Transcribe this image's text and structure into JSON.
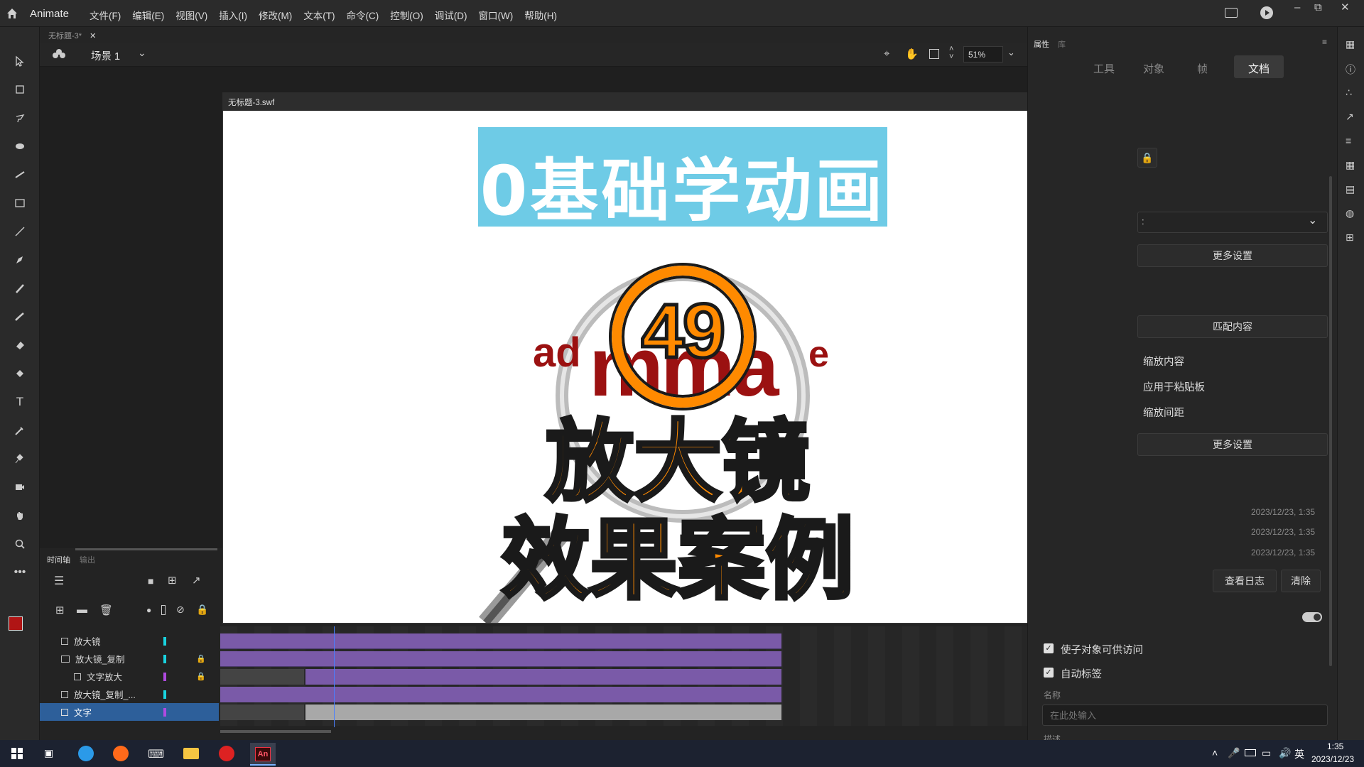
{
  "app": {
    "name": "Animate"
  },
  "menu": [
    "文件(F)",
    "编辑(E)",
    "视图(V)",
    "插入(I)",
    "修改(M)",
    "文本(T)",
    "命令(C)",
    "控制(O)",
    "调试(D)",
    "窗口(W)",
    "帮助(H)"
  ],
  "doc_tab": "无标题-3*",
  "scene": {
    "label": "场景 1",
    "zoom": "51%"
  },
  "swf_window": {
    "title": "无标题-3.swf"
  },
  "stage_content": {
    "banner": "0基础学动画",
    "number": "49",
    "word_left": "ad",
    "word_mid": "mma",
    "word_right": "e",
    "title_line1": "放大镜",
    "title_line2": "效果案例"
  },
  "timeline": {
    "tabs": [
      "时间轴",
      "输出"
    ],
    "layers": [
      {
        "name": "放大镜",
        "color": "#19d4e0",
        "locked": false
      },
      {
        "name": "放大镜_复制",
        "color": "#19d4e0",
        "locked": true
      },
      {
        "name": "文字放大",
        "color": "#b04ae0",
        "locked": true
      },
      {
        "name": "放大镜_复制_...",
        "color": "#19d4e0",
        "locked": false
      },
      {
        "name": "文字",
        "color": "#b04ae0",
        "locked": false
      }
    ]
  },
  "properties": {
    "panel_tabs": [
      "属性",
      "库"
    ],
    "tabs": [
      "工具",
      "对象",
      "帧",
      "文档"
    ],
    "active_tab": "文档",
    "dropdown_value": ":",
    "more_settings_1": "更多设置",
    "match_content": "匹配内容",
    "scale_content": "缩放内容",
    "apply_clipboard": "应用于粘贴板",
    "scale_spacing": "缩放间距",
    "more_settings_2": "更多设置",
    "dates": [
      "2023/12/23, 1:35",
      "2023/12/23, 1:35",
      "2023/12/23, 1:35"
    ],
    "view_log": "查看日志",
    "clear": "清除",
    "accessible_label": "使子对象可供访问",
    "auto_label": "自动标签",
    "name_label": "名称",
    "name_placeholder": "在此处输入",
    "desc_label": "描述"
  },
  "taskbar": {
    "lang": "英",
    "time": "1:35",
    "date": "2023/12/23"
  },
  "colors": {
    "accent_orange": "#ff8a00",
    "banner_blue": "#6ecbe6",
    "dark_red": "#9b1111",
    "timeline_purple": "#7a5aa8",
    "selected_row": "#2d5f9a"
  }
}
